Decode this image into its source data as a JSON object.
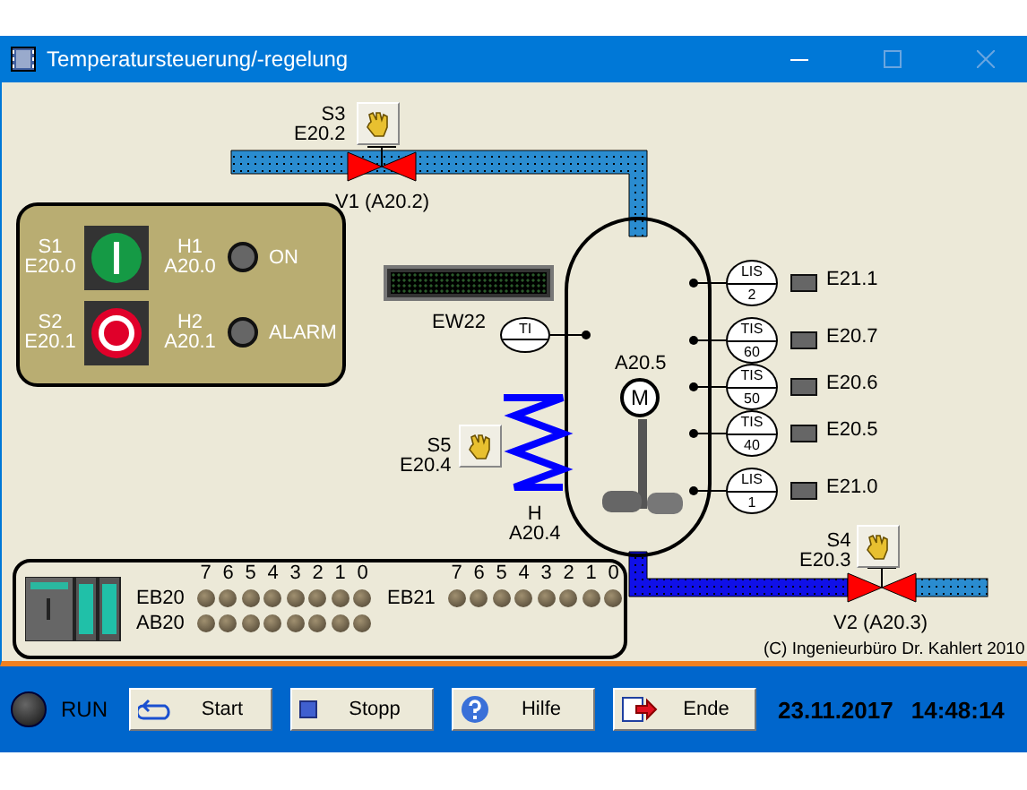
{
  "window": {
    "title": "Temperatursteuerung/-regelung"
  },
  "switches": [
    {
      "label": "S3",
      "address": "E20.2"
    },
    {
      "label": "S5",
      "address": "E20.4"
    },
    {
      "label": "S4",
      "address": "E20.3"
    }
  ],
  "valves": [
    {
      "label": "V1 (A20.2)",
      "open": false
    },
    {
      "label": "V2 (A20.3)",
      "open": false
    }
  ],
  "control_panel": {
    "buttons": [
      {
        "kind": "start",
        "label": "S1",
        "address": "E20.0"
      },
      {
        "kind": "stop",
        "label": "S2",
        "address": "E20.1"
      }
    ],
    "lamps": [
      {
        "label": "H1",
        "address": "A20.0",
        "text": "ON",
        "on": false
      },
      {
        "label": "H2",
        "address": "A20.1",
        "text": "ALARM",
        "on": false
      }
    ]
  },
  "display": {
    "label": "EW22"
  },
  "indicator": {
    "text": "TI"
  },
  "motor": {
    "address": "A20.5",
    "symbol": "M"
  },
  "sensors": [
    {
      "type": "LIS",
      "value": "2",
      "input": "E21.1",
      "on": false
    },
    {
      "type": "TIS",
      "value": "60",
      "input": "E20.7",
      "on": false
    },
    {
      "type": "TIS",
      "value": "50",
      "input": "E20.6",
      "on": false
    },
    {
      "type": "TIS",
      "value": "40",
      "input": "E20.5",
      "on": false
    },
    {
      "type": "LIS",
      "value": "1",
      "input": "E21.0",
      "on": false
    }
  ],
  "heater": {
    "label": "H",
    "address": "A20.4"
  },
  "io_panel": {
    "groups": [
      {
        "bit_labels": [
          "7",
          "6",
          "5",
          "4",
          "3",
          "2",
          "1",
          "0"
        ],
        "rows": [
          {
            "label": "EB20",
            "leds": [
              false,
              false,
              false,
              false,
              false,
              false,
              false,
              false
            ]
          },
          {
            "label": "AB20",
            "leds": [
              false,
              false,
              false,
              false,
              false,
              false,
              false,
              false
            ]
          }
        ]
      },
      {
        "bit_labels": [
          "7",
          "6",
          "5",
          "4",
          "3",
          "2",
          "1",
          "0"
        ],
        "rows": [
          {
            "label": "EB21",
            "leds": [
              false,
              false,
              false,
              false,
              false,
              false,
              false,
              false
            ]
          }
        ]
      }
    ]
  },
  "copyright": "(C) Ingenieurbüro Dr. Kahlert 2010",
  "status_bar": {
    "run": {
      "label": "RUN",
      "on": false
    },
    "buttons": [
      {
        "kind": "start",
        "label": "Start"
      },
      {
        "kind": "stop",
        "label": "Stopp"
      },
      {
        "kind": "help",
        "label": "Hilfe"
      },
      {
        "kind": "exit",
        "label": "Ende"
      }
    ],
    "date": "23.11.2017",
    "time": "14:48:14"
  }
}
